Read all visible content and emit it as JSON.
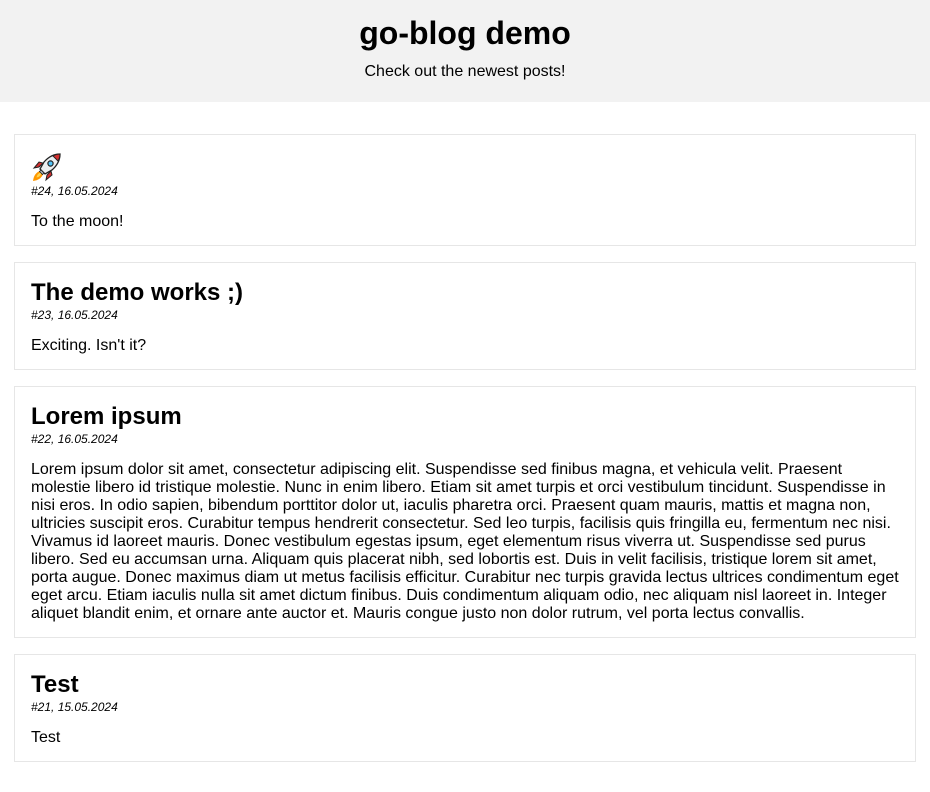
{
  "header": {
    "title": "go-blog demo",
    "subtitle": "Check out the newest posts!"
  },
  "posts": [
    {
      "title": "",
      "title_icon": "rocket-icon",
      "meta": "#24, 16.05.2024",
      "body": "To the moon!"
    },
    {
      "title": "The demo works ;)",
      "meta": "#23, 16.05.2024",
      "body": "Exciting. Isn't it?"
    },
    {
      "title": "Lorem ipsum",
      "meta": "#22, 16.05.2024",
      "body": "Lorem ipsum dolor sit amet, consectetur adipiscing elit. Suspendisse sed finibus magna, et vehicula velit. Praesent molestie libero id tristique molestie. Nunc in enim libero. Etiam sit amet turpis et orci vestibulum tincidunt. Suspendisse in nisi eros. In odio sapien, bibendum porttitor dolor ut, iaculis pharetra orci. Praesent quam mauris, mattis et magna non, ultricies suscipit eros. Curabitur tempus hendrerit consectetur. Sed leo turpis, facilisis quis fringilla eu, fermentum nec nisi. Vivamus id laoreet mauris. Donec vestibulum egestas ipsum, eget elementum risus viverra ut. Suspendisse sed purus libero. Sed eu accumsan urna. Aliquam quis placerat nibh, sed lobortis est. Duis in velit facilisis, tristique lorem sit amet, porta augue. Donec maximus diam ut metus facilisis efficitur. Curabitur nec turpis gravida lectus ultrices condimentum eget eget arcu. Etiam iaculis nulla sit amet dictum finibus. Duis condimentum aliquam odio, nec aliquam nisl laoreet in. Integer aliquet blandit enim, et ornare ante auctor et. Mauris congue justo non dolor rutrum, vel porta lectus convallis."
    },
    {
      "title": "Test",
      "meta": "#21, 15.05.2024",
      "body": "Test"
    }
  ]
}
